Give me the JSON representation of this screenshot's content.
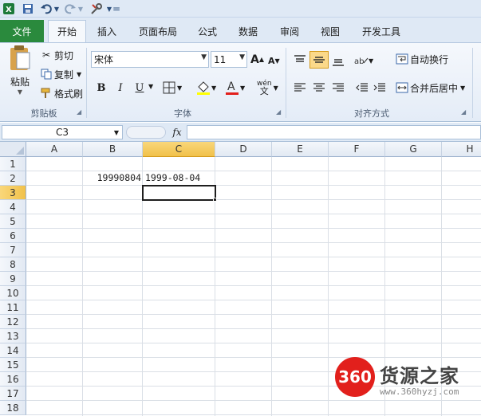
{
  "quick_access": {
    "dropdown": "="
  },
  "tabs": [
    {
      "label": "文件"
    },
    {
      "label": "开始"
    },
    {
      "label": "插入"
    },
    {
      "label": "页面布局"
    },
    {
      "label": "公式"
    },
    {
      "label": "数据"
    },
    {
      "label": "审阅"
    },
    {
      "label": "视图"
    },
    {
      "label": "开发工具"
    }
  ],
  "ribbon": {
    "clipboard": {
      "paste": "粘贴",
      "cut": "剪切",
      "copy": "复制",
      "format_painter": "格式刷",
      "label": "剪贴板"
    },
    "font": {
      "name": "宋体",
      "size": "11",
      "grow": "A",
      "shrink": "A",
      "bold": "B",
      "italic": "I",
      "underline": "U",
      "label": "字体",
      "phonetic": "wén"
    },
    "alignment": {
      "wrap": "自动换行",
      "merge": "合并后居中",
      "label": "对齐方式"
    }
  },
  "formula_bar": {
    "name_box": "C3",
    "fx": "fx",
    "formula": ""
  },
  "grid": {
    "columns": [
      "A",
      "B",
      "C",
      "D",
      "E",
      "F",
      "G",
      "H"
    ],
    "rows": [
      "1",
      "2",
      "3",
      "4",
      "5",
      "6",
      "7",
      "8",
      "9",
      "10",
      "11",
      "12",
      "13",
      "14",
      "15",
      "16",
      "17",
      "18"
    ],
    "selected_column": "C",
    "selected_row": "3",
    "cells": {
      "B2": "19990804",
      "C2": "1999-08-04"
    }
  },
  "watermark": {
    "badge": "360",
    "name": "货源之家",
    "url": "www.360hyzj.com"
  },
  "colors": {
    "file_tab": "#2a8a3d",
    "selection": "#f1c14a",
    "watermark_red": "#e2201c"
  }
}
